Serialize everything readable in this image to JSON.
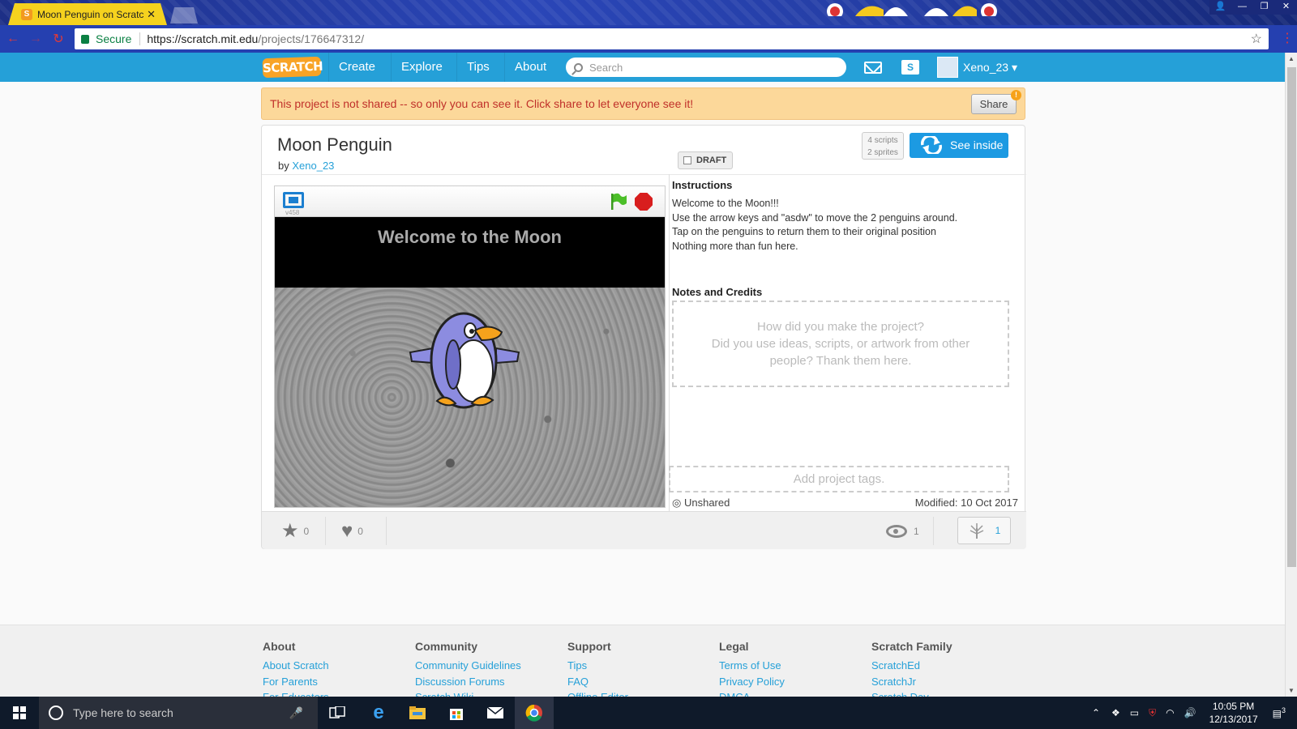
{
  "browser": {
    "tab_title": "Moon Penguin on Scratch",
    "secure_label": "Secure",
    "url_host": "https://scratch.mit.edu",
    "url_path": "/projects/176647312/"
  },
  "nav": {
    "logo": "SCRATCH",
    "links": [
      "Create",
      "Explore",
      "Tips",
      "About"
    ],
    "search_placeholder": "Search",
    "username": "Xeno_23 ▾"
  },
  "notice": {
    "text": "This project is not shared -- so only you can see it. Click share to let everyone see it!",
    "share_label": "Share",
    "alert_badge": "!"
  },
  "project": {
    "title": "Moon Penguin",
    "by_label": "by",
    "author": "Xeno_23",
    "draft_label": "DRAFT",
    "scripts": "4 scripts",
    "sprites": "2 sprites",
    "see_inside_label": "See inside",
    "version": "v458",
    "stage_text": "Welcome to the Moon",
    "instructions_head": "Instructions",
    "instructions": [
      "Welcome to the Moon!!!",
      "Use the arrow keys and \"asdw\" to move the 2 penguins around.",
      "Tap on the penguins to return them to their original position",
      "Nothing more than fun here."
    ],
    "notes_head": "Notes and Credits",
    "notes_placeholder": [
      "How did you make the project?",
      "Did you use ideas, scripts, or artwork from other",
      "people? Thank them here."
    ],
    "tags_placeholder": "Add project tags.",
    "unshared_label": "Unshared",
    "modified_label": "Modified: 10 Oct 2017",
    "favorites": "0",
    "loves": "0",
    "views": "1",
    "remixes": "1"
  },
  "footer": {
    "columns": [
      {
        "title": "About",
        "links": [
          "About Scratch",
          "For Parents",
          "For Educators"
        ]
      },
      {
        "title": "Community",
        "links": [
          "Community Guidelines",
          "Discussion Forums",
          "Scratch Wiki"
        ]
      },
      {
        "title": "Support",
        "links": [
          "Tips",
          "FAQ",
          "Offline Editor"
        ]
      },
      {
        "title": "Legal",
        "links": [
          "Terms of Use",
          "Privacy Policy",
          "DMCA"
        ]
      },
      {
        "title": "Scratch Family",
        "links": [
          "ScratchEd",
          "ScratchJr",
          "Scratch Day"
        ]
      }
    ]
  },
  "taskbar": {
    "search_placeholder": "Type here to search",
    "time": "10:05 PM",
    "date": "12/13/2017",
    "notification_count": "3"
  },
  "colors": {
    "scratch_blue": "#25a0d8",
    "notice_bg": "#fcd89a",
    "notice_text": "#c0302a",
    "see_inside": "#1c9ae2"
  }
}
